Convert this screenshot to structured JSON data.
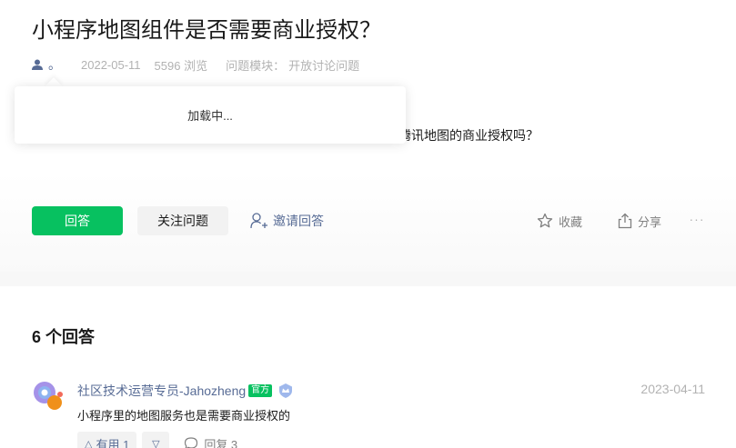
{
  "question": {
    "title": "小程序地图组件是否需要商业授权？",
    "author_name": "。",
    "date": "2022-05-11",
    "views": "5596 浏览",
    "module_label": "问题模块：",
    "module_value": "开放讨论问题",
    "body_text": "腾讯地图的商业授权吗？"
  },
  "popup": {
    "loading_text": "加载中..."
  },
  "actions": {
    "answer_label": "回答",
    "follow_label": "关注问题",
    "invite_label": "邀请回答",
    "collect_label": "收藏",
    "share_label": "分享",
    "more_label": "···"
  },
  "answers": {
    "heading": "6 个回答",
    "items": [
      {
        "author": "社区技术运营专员-Jahozheng",
        "badge": "官方",
        "date": "2023-04-11",
        "text": "小程序里的地图服务也是需要商业授权的",
        "upvote_label": "有用 1",
        "reply_label": "回复 3"
      }
    ]
  },
  "colors": {
    "accent": "#07c160",
    "link": "#576b95",
    "muted": "#b2b2b2"
  },
  "icons": {
    "author": "user-icon",
    "invite": "add-user-icon",
    "collect": "star-icon",
    "share": "share-icon",
    "reply": "comment-icon"
  }
}
